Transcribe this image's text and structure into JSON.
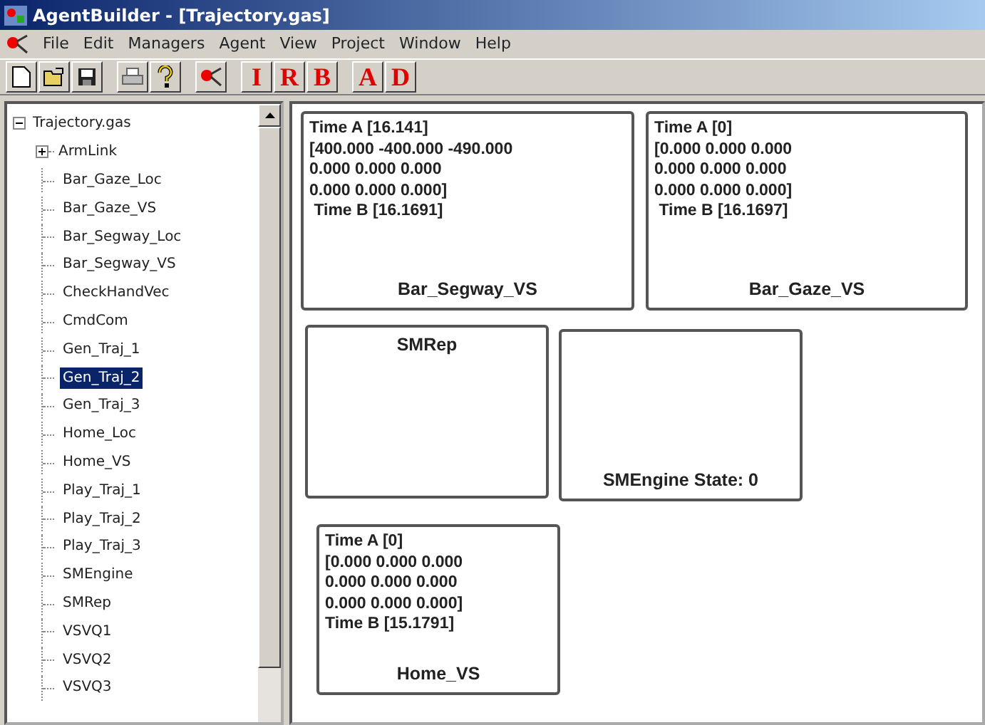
{
  "window": {
    "title": "AgentBuilder - [Trajectory.gas]"
  },
  "menu": [
    "File",
    "Edit",
    "Managers",
    "Agent",
    "View",
    "Project",
    "Window",
    "Help"
  ],
  "toolbar": [
    {
      "kind": "new"
    },
    {
      "kind": "open"
    },
    {
      "kind": "save"
    },
    {
      "kind": "sep"
    },
    {
      "kind": "print"
    },
    {
      "kind": "help"
    },
    {
      "kind": "sep"
    },
    {
      "kind": "agent"
    },
    {
      "kind": "sep"
    },
    {
      "kind": "letter",
      "label": "I"
    },
    {
      "kind": "letter",
      "label": "R"
    },
    {
      "kind": "letter",
      "label": "B"
    },
    {
      "kind": "sep"
    },
    {
      "kind": "letter",
      "label": "A"
    },
    {
      "kind": "letter",
      "label": "D"
    }
  ],
  "tree": {
    "label": "Trajectory.gas",
    "expanded": true,
    "children": [
      {
        "label": "ArmLink",
        "expanded": false,
        "selected": false
      },
      {
        "label": "Bar_Gaze_Loc",
        "selected": false
      },
      {
        "label": "Bar_Gaze_VS",
        "selected": false
      },
      {
        "label": "Bar_Segway_Loc",
        "selected": false
      },
      {
        "label": "Bar_Segway_VS",
        "selected": false
      },
      {
        "label": "CheckHandVec",
        "selected": false
      },
      {
        "label": "CmdCom",
        "selected": false
      },
      {
        "label": "Gen_Traj_1",
        "selected": false
      },
      {
        "label": "Gen_Traj_2",
        "selected": true
      },
      {
        "label": "Gen_Traj_3",
        "selected": false
      },
      {
        "label": "Home_Loc",
        "selected": false
      },
      {
        "label": "Home_VS",
        "selected": false
      },
      {
        "label": "Play_Traj_1",
        "selected": false
      },
      {
        "label": "Play_Traj_2",
        "selected": false
      },
      {
        "label": "Play_Traj_3",
        "selected": false
      },
      {
        "label": "SMEngine",
        "selected": false
      },
      {
        "label": "SMRep",
        "selected": false
      },
      {
        "label": "VSVQ1",
        "selected": false
      },
      {
        "label": "VSVQ2",
        "selected": false
      },
      {
        "label": "VSVQ3",
        "selected": false
      }
    ]
  },
  "nodes": [
    {
      "lines": [
        "Time A [16.141]",
        "[400.000 -400.000 -490.000",
        "0.000 0.000 0.000",
        "0.000 0.000 0.000]",
        " Time B [16.1691]"
      ],
      "caption": "Bar_Segway_VS"
    },
    {
      "lines": [
        "Time A [0]",
        "[0.000 0.000 0.000",
        "0.000 0.000 0.000",
        "0.000 0.000 0.000]",
        " Time B [16.1697]"
      ],
      "caption": "Bar_Gaze_VS"
    },
    {
      "title": "SMRep"
    },
    {
      "caption": "SMEngine State: 0"
    },
    {
      "lines": [
        "Time A [0]",
        "[0.000 0.000 0.000",
        "0.000 0.000 0.000",
        "0.000 0.000 0.000]",
        "Time B [15.1791]"
      ],
      "caption": "Home_VS"
    }
  ]
}
